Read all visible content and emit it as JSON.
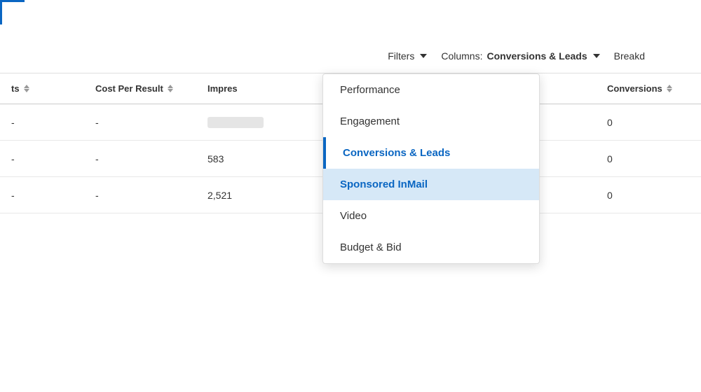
{
  "corner": {},
  "toolbar": {
    "filters_label": "Filters",
    "columns_prefix": "Columns: ",
    "columns_value": "Conversions & Leads",
    "breakd_label": "Breakd"
  },
  "table": {
    "headers": [
      {
        "id": "results",
        "label": "ts",
        "sortable": true
      },
      {
        "id": "cost",
        "label": "Cost Per Result",
        "sortable": true
      },
      {
        "id": "impressions",
        "label": "Impres",
        "sortable": false
      },
      {
        "id": "conversions",
        "label": "Conversions",
        "sortable": true
      }
    ],
    "rows": [
      {
        "results": "-",
        "cost": "-",
        "impressions": "blur",
        "conversions": "0",
        "highlighted": false
      },
      {
        "results": "-",
        "cost": "-",
        "impressions": "583",
        "conversions": "0",
        "highlighted": false
      },
      {
        "results": "-",
        "cost": "-",
        "impressions": "2,521",
        "conversions": "0",
        "highlighted": false
      }
    ]
  },
  "dropdown": {
    "items": [
      {
        "id": "performance",
        "label": "Performance",
        "state": "normal"
      },
      {
        "id": "engagement",
        "label": "Engagement",
        "state": "normal"
      },
      {
        "id": "conversions-leads",
        "label": "Conversions & Leads",
        "state": "active"
      },
      {
        "id": "sponsored-inmail",
        "label": "Sponsored InMail",
        "state": "selected-hover"
      },
      {
        "id": "video",
        "label": "Video",
        "state": "normal"
      },
      {
        "id": "budget-bid",
        "label": "Budget & Bid",
        "state": "normal"
      }
    ]
  }
}
